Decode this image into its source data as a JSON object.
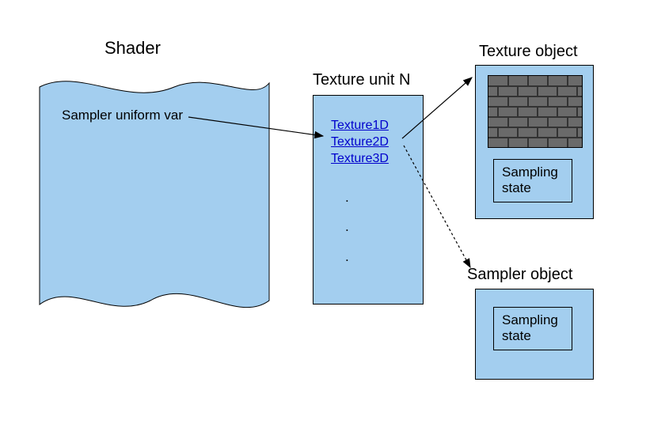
{
  "colors": {
    "fill": "#a3ceef",
    "stroke": "#000000",
    "link": "#0000cc"
  },
  "shader": {
    "title": "Shader",
    "label": "Sampler uniform var"
  },
  "textureUnit": {
    "title": "Texture unit N",
    "items": [
      "Texture1D",
      "Texture2D",
      "Texture3D"
    ],
    "dots": ". . ."
  },
  "textureObject": {
    "title": "Texture object",
    "samplingLabel": "Sampling state"
  },
  "samplerObject": {
    "title": "Sampler object",
    "samplingLabel": "Sampling state"
  }
}
